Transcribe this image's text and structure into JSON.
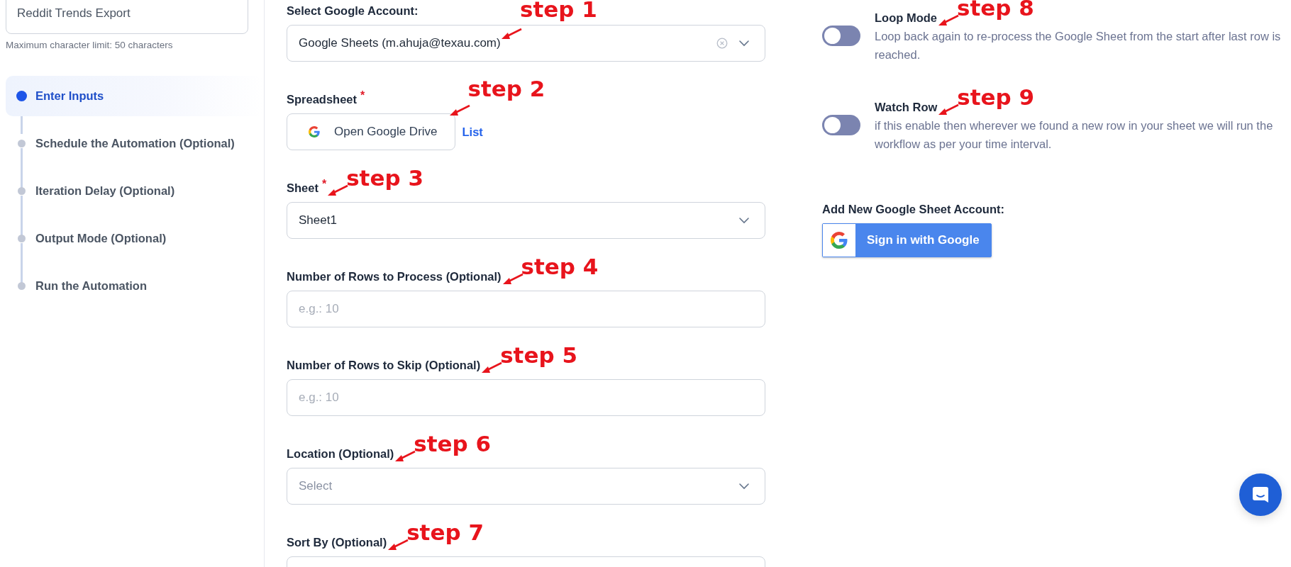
{
  "sidebar": {
    "name_field": {
      "value": "Reddit Trends Export"
    },
    "hint": "Maximum character limit: 50 characters",
    "steps": [
      {
        "label": "Enter Inputs",
        "selected": true
      },
      {
        "label": "Schedule the Automation (Optional)",
        "selected": false
      },
      {
        "label": "Iteration Delay (Optional)",
        "selected": false
      },
      {
        "label": "Output Mode (Optional)",
        "selected": false
      },
      {
        "label": "Run the Automation",
        "selected": false
      }
    ]
  },
  "form": {
    "fields": [
      {
        "kind": "select",
        "label": "Select Google Account:",
        "value": "Google Sheets (m.ahuja@texau.com)",
        "clearable": true,
        "annotation": "step 1"
      },
      {
        "kind": "drive",
        "label": "Spreadsheet",
        "required_mark": "*",
        "button": "Open Google Drive",
        "link": "List",
        "annotation": "step 2"
      },
      {
        "kind": "select",
        "label": "Sheet",
        "required_mark": "*",
        "value": "Sheet1",
        "clearable": false,
        "annotation": "step 3"
      },
      {
        "kind": "input",
        "label": "Number of Rows to Process (Optional)",
        "placeholder": "e.g.: 10",
        "annotation": "step 4"
      },
      {
        "kind": "input",
        "label": "Number of Rows to Skip (Optional)",
        "placeholder": "e.g.: 10",
        "annotation": "step 5"
      },
      {
        "kind": "select",
        "label": "Location (Optional)",
        "placeholder": "Select",
        "clearable": false,
        "annotation": "step 6"
      },
      {
        "kind": "select",
        "label": "Sort By (Optional)",
        "annotation": "step 7"
      }
    ]
  },
  "options": [
    {
      "label": "Loop Mode",
      "description": "Loop back again to re-process the Google Sheet from the start after last row is reached.",
      "on": false,
      "annotation": "step 8"
    },
    {
      "label": "Watch Row",
      "description": "if this enable then wherever we found a new row in your sheet we will run the workflow as per your time interval.",
      "on": false,
      "annotation": "step 9"
    }
  ],
  "add_account": {
    "label": "Add New Google Sheet Account:",
    "button": "Sign in with Google"
  }
}
